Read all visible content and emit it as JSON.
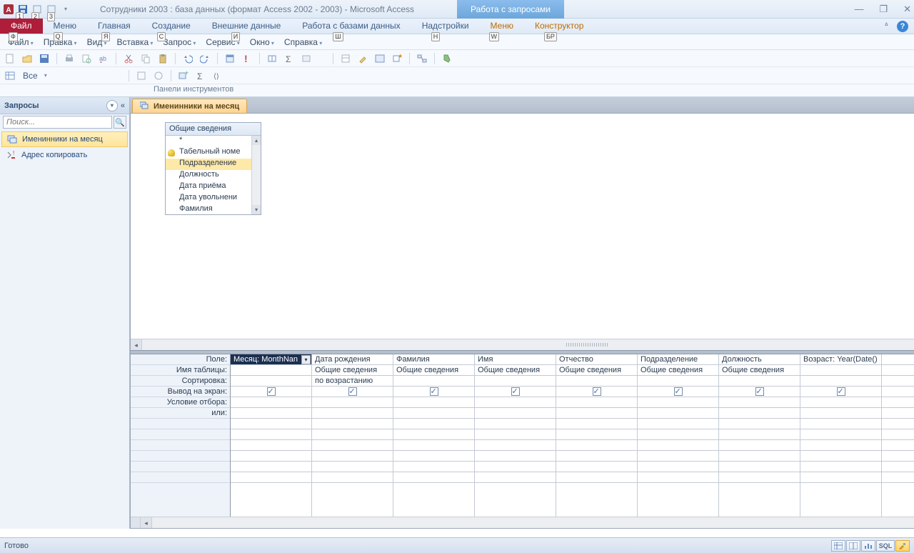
{
  "title": "Сотрудники 2003 : база данных (формат Access 2002 - 2003)  -  Microsoft Access",
  "context_tab_title": "Работа с запросами",
  "ribbon_tabs": {
    "file": "Файл",
    "t1": "Меню",
    "t2": "Главная",
    "t3": "Создание",
    "t4": "Внешние данные",
    "t5": "Работа с базами данных",
    "t6": "Надстройки",
    "t7": "Меню",
    "t8": "Конструктор"
  },
  "keys": {
    "file": "Ф",
    "t1": "Q",
    "t2": "Я",
    "t3": "С",
    "t4": "И",
    "t5": "Ш",
    "t6": "Н",
    "t7": "W",
    "t8": "БР"
  },
  "menus": {
    "m0": "Файл",
    "m1": "Правка",
    "m2": "Вид",
    "m3": "Вставка",
    "m4": "Запрос",
    "m5": "Сервис",
    "m6": "Окно",
    "m7": "Справка"
  },
  "toolbar2_all": "Все",
  "panel_label": "Панели инструментов",
  "nav": {
    "header": "Запросы",
    "search_placeholder": "Поиск...",
    "items": {
      "i0": "Именинники на месяц",
      "i1": "Адрес копировать"
    }
  },
  "doc_tab": "Именинники на месяц",
  "table_box": {
    "title": "Общие сведения",
    "f_star": "*",
    "f0": "Табельный номе",
    "f1": "Подразделение",
    "f2": "Должность",
    "f3": "Дата приёма",
    "f4": "Дата увольнени",
    "f5": "Фамилия"
  },
  "grid_labels": {
    "r0": "Поле:",
    "r1": "Имя таблицы:",
    "r2": "Сортировка:",
    "r3": "Вывод на экран:",
    "r4": "Условие отбора:",
    "r5": "или:"
  },
  "columns": [
    {
      "field": "Месяц: MonthNan",
      "table": "",
      "sort": "",
      "show": true,
      "sel": true
    },
    {
      "field": "Дата рождения",
      "table": "Общие сведения",
      "sort": "по возрастанию",
      "show": true
    },
    {
      "field": "Фамилия",
      "table": "Общие сведения",
      "sort": "",
      "show": true
    },
    {
      "field": "Имя",
      "table": "Общие сведения",
      "sort": "",
      "show": true
    },
    {
      "field": "Отчество",
      "table": "Общие сведения",
      "sort": "",
      "show": true
    },
    {
      "field": "Подразделение",
      "table": "Общие сведения",
      "sort": "",
      "show": true
    },
    {
      "field": "Должность",
      "table": "Общие сведения",
      "sort": "",
      "show": true
    },
    {
      "field": "Возраст: Year(Date()",
      "table": "",
      "sort": "",
      "show": true
    }
  ],
  "status": "Готово",
  "sql": "SQL"
}
